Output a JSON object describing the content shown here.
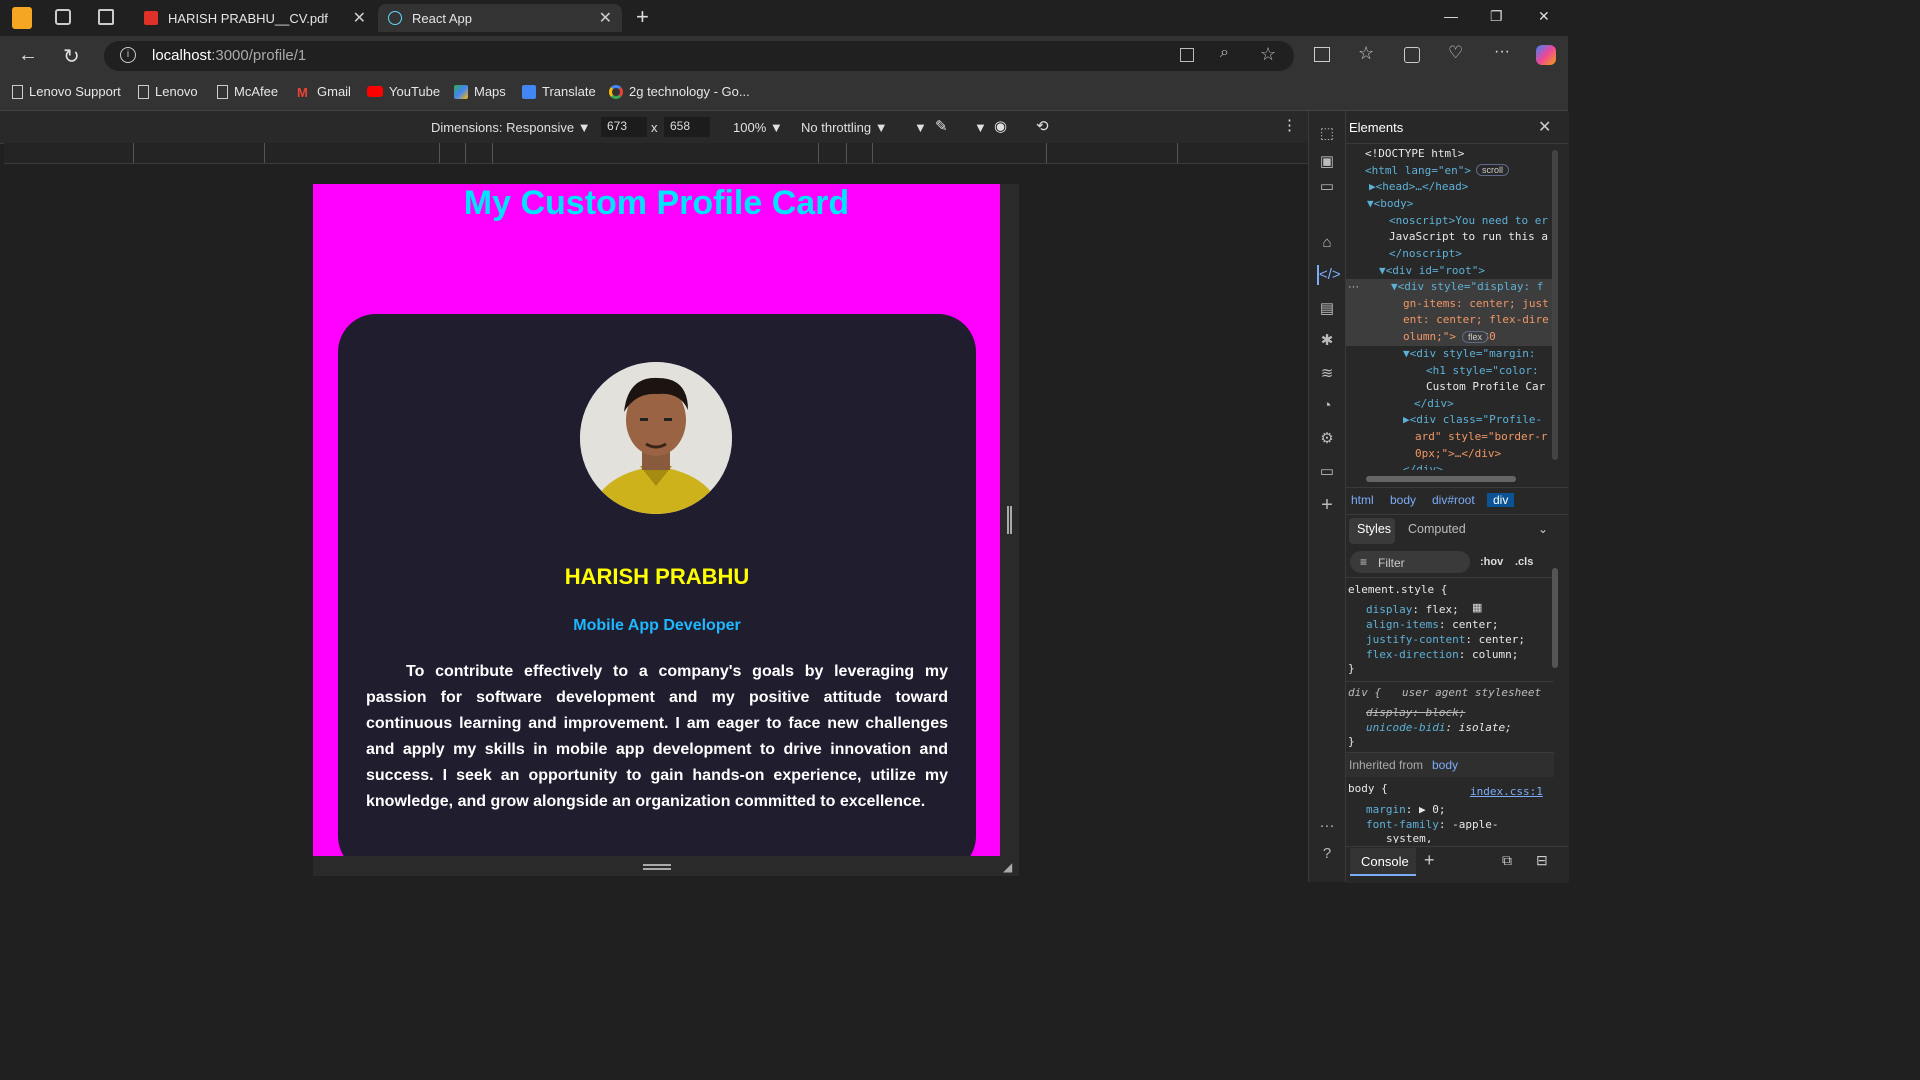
{
  "browser": {
    "tabs": [
      {
        "title": "HARISH PRABHU__CV.pdf",
        "icon": "pdf-icon"
      },
      {
        "title": "React App",
        "icon": "react-icon"
      }
    ],
    "url_host": "localhost",
    "url_path": ":3000/profile/1",
    "bookmarks": [
      {
        "label": "Lenovo Support",
        "icon": "page-icon"
      },
      {
        "label": "Lenovo",
        "icon": "page-icon"
      },
      {
        "label": "McAfee",
        "icon": "page-icon"
      },
      {
        "label": "Gmail",
        "icon": "gmail-icon"
      },
      {
        "label": "YouTube",
        "icon": "youtube-icon"
      },
      {
        "label": "Maps",
        "icon": "maps-icon"
      },
      {
        "label": "Translate",
        "icon": "translate-icon"
      },
      {
        "label": "2g technology - Go...",
        "icon": "google-icon"
      }
    ]
  },
  "device_toolbar": {
    "dimensions_label": "Dimensions: Responsive",
    "width": "673",
    "height": "658",
    "times": "x",
    "zoom": "100%",
    "throttling": "No throttling"
  },
  "page": {
    "title": "My Custom Profile Card",
    "background": "#ff00ff",
    "profile": {
      "name": "HARISH PRABHU",
      "role": "Mobile App Developer",
      "objective": "To contribute effectively to a company's goals by leveraging my passion for software development and my positive attitude toward continuous learning and improvement. I am eager to face new challenges and apply my skills in mobile app development to drive innovation and success. I seek an opportunity to gain hands-on experience, utilize my knowledge, and grow alongside an organization committed to excellence."
    }
  },
  "devtools": {
    "panel_title": "Elements",
    "breadcrumbs": [
      "html",
      "body",
      "div#root",
      "div"
    ],
    "style_tabs": [
      "Styles",
      "Computed"
    ],
    "filter_placeholder": "Filter",
    "hov": ":hov",
    "cls": ".cls",
    "dom_lines": [
      "<!DOCTYPE html>",
      "<html lang=\"en\">",
      "▶<head>…</head>",
      "▼<body>",
      "<noscript>You need to er",
      "JavaScript to run this a",
      "</noscript>",
      "▼<div id=\"root\">",
      "▼<div style=\"display: f",
      "gn-items: center; just",
      "ent: center; flex-dire",
      "olumn;\"> == $0",
      "▼<div style=\"margin:",
      "<h1 style=\"color: ",
      "Custom Profile Car",
      "</div>",
      "▶<div class=\"Profile-",
      "ard\" style=\"border-r",
      "0px;\">…</div>",
      "</div>"
    ],
    "badges": {
      "scroll": "scroll",
      "flex": "flex"
    },
    "element_style_selector": "element.style {",
    "element_style_props": [
      {
        "name": "display",
        "value": "flex;"
      },
      {
        "name": "align-items",
        "value": "center;"
      },
      {
        "name": "justify-content",
        "value": "center;"
      },
      {
        "name": "flex-direction",
        "value": "column;"
      }
    ],
    "ua_selector": "div {",
    "ua_label": "user agent stylesheet",
    "ua_props": [
      {
        "name": "display",
        "value": "block;"
      },
      {
        "name": "unicode-bidi",
        "value": "isolate;"
      }
    ],
    "inherited_label": "Inherited from",
    "inherited_from": "body",
    "body_selector": "body {",
    "body_source": "index.css:1",
    "body_props": [
      {
        "name": "margin",
        "value": "▶ 0;"
      },
      {
        "name": "font-family",
        "value": "-apple-"
      },
      {
        "name": "",
        "value": "system,"
      }
    ],
    "close_brace": "}",
    "console_label": "Console"
  }
}
